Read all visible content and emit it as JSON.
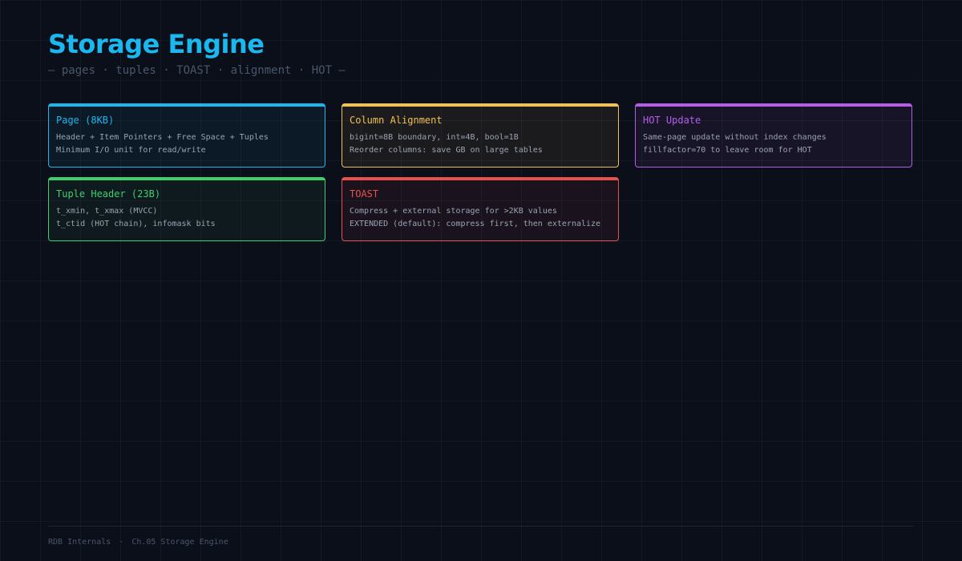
{
  "header": {
    "title": "Storage Engine",
    "subtitle": "— pages · tuples · TOAST · alignment · HOT —"
  },
  "cards": [
    {
      "title": "Page (8KB)",
      "lines": [
        "Header + Item Pointers + Free Space + Tuples",
        "Minimum I/O unit for read/write"
      ],
      "color": "#1ab8ef"
    },
    {
      "title": "Column Alignment",
      "lines": [
        "bigint=8B boundary, int=4B, bool=1B",
        "Reorder columns: save GB on large tables"
      ],
      "color": "#f2c14e"
    },
    {
      "title": "HOT Update",
      "lines": [
        "Same-page update without index changes",
        "fillfactor=70 to leave room for HOT"
      ],
      "color": "#b45ee8"
    },
    {
      "title": "Tuple Header (23B)",
      "lines": [
        "t_xmin, t_xmax (MVCC)",
        "t_ctid (HOT chain), infomask bits"
      ],
      "color": "#3fcf6d"
    },
    {
      "title": "TOAST",
      "lines": [
        "Compress + external storage for >2KB values",
        "EXTENDED (default): compress first, then externalize"
      ],
      "color": "#e8514f"
    }
  ],
  "footer": {
    "book": "RDB Internals",
    "separator": "·",
    "chapter": "Ch.05 Storage Engine"
  },
  "colors": {
    "background": "#0b0f1a",
    "accent": "#1ab8ef",
    "muted": "#4b5669",
    "body_text": "#9aa3b2"
  }
}
